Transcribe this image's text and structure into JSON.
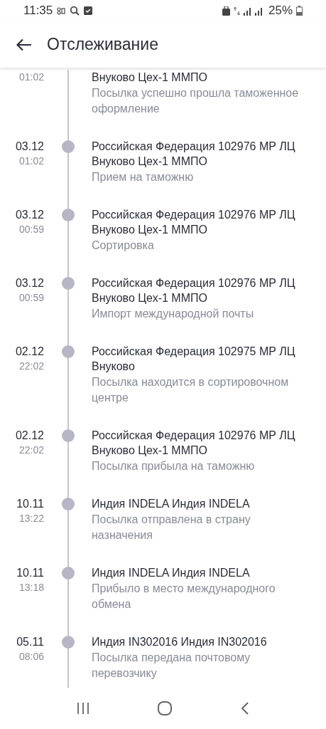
{
  "status_bar": {
    "time": "11:35",
    "battery": "25%"
  },
  "header": {
    "title": "Отслеживание"
  },
  "events": [
    {
      "time": "01:02",
      "place": "Внуково Цех-1 ММПО",
      "status": "Посылка успешно прошла таможенное оформление"
    },
    {
      "date": "03.12",
      "time": "01:02",
      "place": "Российская Федерация 102976 МР ЛЦ Внуково Цех-1 ММПО",
      "status": "Прием на таможню"
    },
    {
      "date": "03.12",
      "time": "00:59",
      "place": "Российская Федерация 102976 МР ЛЦ Внуково Цех-1 ММПО",
      "status": "Сортировка"
    },
    {
      "date": "03.12",
      "time": "00:59",
      "place": "Российская Федерация 102976 МР ЛЦ Внуково Цех-1 ММПО",
      "status": "Импорт международной почты"
    },
    {
      "date": "02.12",
      "time": "22:02",
      "place": "Российская Федерация 102975 МР ЛЦ Внуково",
      "status": "Посылка находится в сортировочном центре"
    },
    {
      "date": "02.12",
      "time": "22:02",
      "place": "Российская Федерация 102976 МР ЛЦ Внуково Цех-1 ММПО",
      "status": "Посылка прибыла на таможню"
    },
    {
      "date": "10.11",
      "time": "13:22",
      "place": "Индия INDELA Индия INDELA",
      "status": "Посылка отправлена в страну назначения"
    },
    {
      "date": "10.11",
      "time": "13:18",
      "place": "Индия INDELA Индия INDELA",
      "status": "Прибыло в место международного обмена"
    },
    {
      "date": "05.11",
      "time": "08:06",
      "place": "Индия IN302016 Индия IN302016",
      "status": "Посылка передана почтовому перевозчику"
    }
  ]
}
